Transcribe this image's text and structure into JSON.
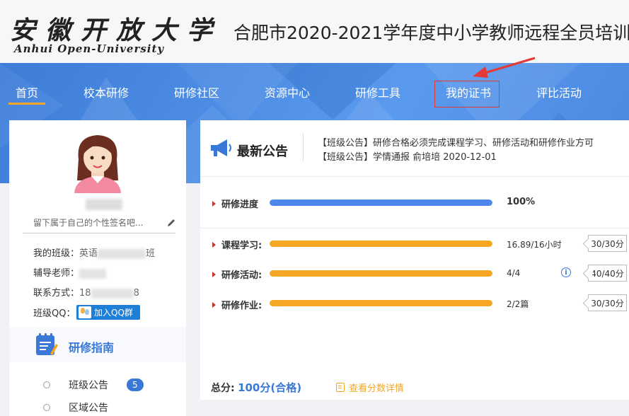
{
  "header": {
    "logo_cn": "安徽开放大学",
    "logo_en": "Anhui Open-University",
    "site_title": "合肥市2020-2021学年度中小学教师远程全员培训"
  },
  "nav": {
    "items": [
      "首页",
      "校本研修",
      "研修社区",
      "资源中心",
      "研修工具",
      "我的证书",
      "评比活动"
    ],
    "active_index": 0,
    "highlighted_index": 5
  },
  "profile": {
    "signature_placeholder": "留下属于自己的个性签名吧...",
    "class_label": "我的班级：",
    "class_value_prefix": "英语",
    "class_value_suffix": "班",
    "tutor_label": "辅导老师：",
    "contact_label": "联系方式：",
    "contact_prefix": "18",
    "contact_suffix": "8",
    "qq_label": "班级QQ：",
    "qq_button": "加入QQ群"
  },
  "guide": {
    "title": "研修指南",
    "items": [
      {
        "label": "班级公告",
        "badge": "5"
      },
      {
        "label": "区域公告"
      }
    ]
  },
  "announcement": {
    "title": "最新公告",
    "lines": [
      "【班级公告】研修合格必须完成课程学习、研修活动和研修作业方可",
      "【班级公告】学情通报        俞培培   2020-12-01"
    ]
  },
  "progress": {
    "overall": {
      "label": "研修进度",
      "value_text": "100%",
      "fraction": 1.0,
      "color": "#4f86ec"
    },
    "items": [
      {
        "label": "课程学习:",
        "value_text": "16.89/16小时",
        "fraction": 1.0,
        "score": "30/30分",
        "color": "#f5a623"
      },
      {
        "label": "研修活动:",
        "value_text": "4/4",
        "fraction": 1.0,
        "score": "40/40分",
        "color": "#f5a623"
      },
      {
        "label": "研修作业:",
        "value_text": "2/2篇",
        "fraction": 1.0,
        "score": "30/30分",
        "color": "#f5a623"
      }
    ]
  },
  "total": {
    "label": "总分:",
    "value": "100分(合格)",
    "detail_link": "查看分数详情"
  },
  "colors": {
    "nav_blue": "#4a88e0",
    "accent_orange": "#f5a623",
    "link_blue": "#3a78d8",
    "highlight_red": "#e53935"
  }
}
